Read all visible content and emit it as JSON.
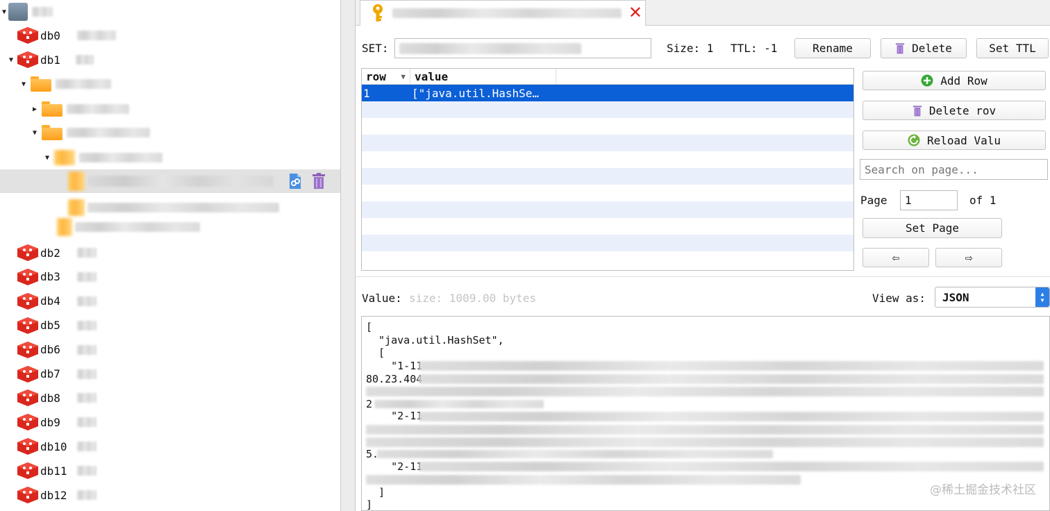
{
  "sidebar": {
    "databases_top": [
      "db0",
      "db1"
    ],
    "databases_bottom": [
      "db2",
      "db3",
      "db4",
      "db5",
      "db6",
      "db7",
      "db8",
      "db9",
      "db10",
      "db11",
      "db12"
    ]
  },
  "tab": {
    "close_glyph": "✕"
  },
  "key_panel": {
    "type_label": "SET:",
    "size_label": "Size: 1",
    "ttl_label": "TTL: -1",
    "rename_label": "Rename",
    "delete_label": "Delete",
    "set_ttl_label": "Set TTL"
  },
  "table": {
    "columns": [
      "row",
      "value"
    ],
    "rows": [
      {
        "row": "1",
        "value": "[\"java.util.HashSe…"
      }
    ]
  },
  "side_controls": {
    "add_row_label": "Add Row",
    "delete_row_label": "Delete rov",
    "reload_label": "Reload Valu",
    "search_placeholder": "Search on page...",
    "page_label": "Page",
    "page_value": "1",
    "of_label": "of 1",
    "set_page_label": "Set Page",
    "prev_glyph": "⇦",
    "next_glyph": "⇨"
  },
  "value_panel": {
    "value_label": "Value:",
    "size_hint": "size: 1009.00 bytes",
    "view_as_label": "View as:",
    "view_as_value": "JSON",
    "lines": [
      "[",
      "  \"java.util.HashSet\",",
      "  [",
      "    \"1-11",
      "80.23.404",
      "2",
      "    \"2-11",
      "5.",
      "    \"2-11",
      "  ]",
      "]"
    ]
  },
  "watermark": "@稀土掘金技术社区",
  "icons": {
    "db": "redis-db-icon",
    "folder": "folder-icon",
    "key": "key-icon",
    "trash": "trash-icon",
    "add": "add-icon",
    "reload": "reload-icon"
  },
  "colors": {
    "selection": "#0b5fd7",
    "db_red": "#d9271e",
    "folder_orange": "#ffa726",
    "close_red": "#e02020"
  }
}
